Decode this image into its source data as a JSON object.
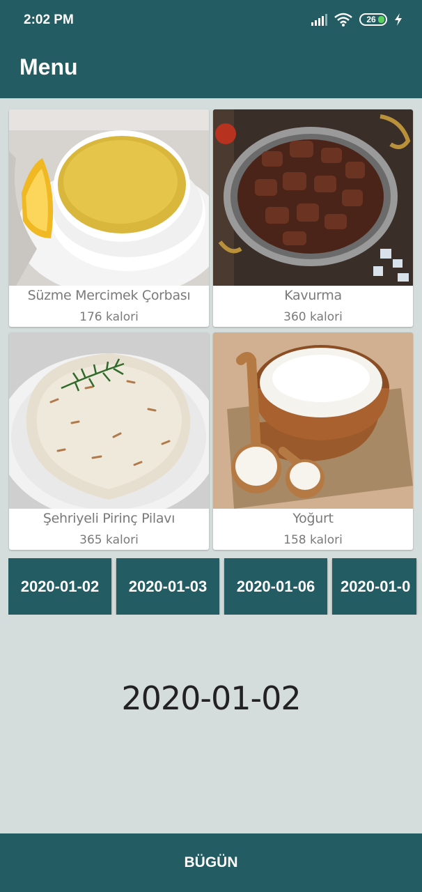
{
  "status": {
    "time": "2:02 PM",
    "battery": "26"
  },
  "appbar": {
    "title": "Menu"
  },
  "menu": {
    "items": [
      {
        "name": "Süzme Mercimek Çorbası",
        "calories": "176 kalori"
      },
      {
        "name": "Kavurma",
        "calories": "360 kalori"
      },
      {
        "name": "Şehriyeli Pirinç Pilavı",
        "calories": "365 kalori"
      },
      {
        "name": "Yoğurt",
        "calories": "158 kalori"
      }
    ]
  },
  "dates": [
    "2020-01-02",
    "2020-01-03",
    "2020-01-06",
    "2020-01-0"
  ],
  "selected_date": "2020-01-02",
  "bottom": {
    "today_label": "BÜGÜN"
  },
  "colors": {
    "primary": "#235d63",
    "background": "#d5dcdc"
  }
}
